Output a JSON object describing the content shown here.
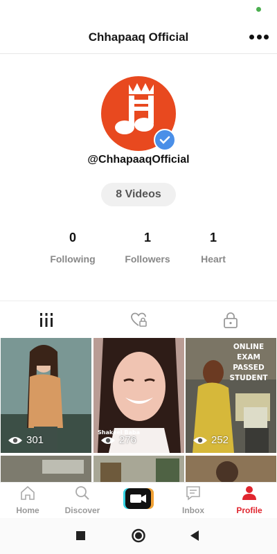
{
  "header": {
    "title": "Chhapaaq Official"
  },
  "profile": {
    "username": "@ChhapaaqOfficial",
    "videos_label": "8 Videos",
    "stats": [
      {
        "value": "0",
        "label": "Following"
      },
      {
        "value": "1",
        "label": "Followers"
      },
      {
        "value": "1",
        "label": "Heart"
      }
    ]
  },
  "tabs": [
    {
      "icon": "grid-bars-icon"
    },
    {
      "icon": "heart-lock-icon"
    },
    {
      "icon": "lock-icon"
    }
  ],
  "videos": [
    {
      "views": "301"
    },
    {
      "views": "276",
      "caption": "Shakeel Baba"
    },
    {
      "views": "252",
      "caption": "ONLINE EXAM PASSED STUDENT"
    }
  ],
  "nav": {
    "home": "Home",
    "discover": "Discover",
    "inbox": "Inbox",
    "profile": "Profile"
  },
  "colors": {
    "brand": "#e8491f",
    "active": "#e0252e",
    "verified": "#4a8fe8",
    "create_left": "#34d3e3",
    "create_right": "#f2a134"
  }
}
